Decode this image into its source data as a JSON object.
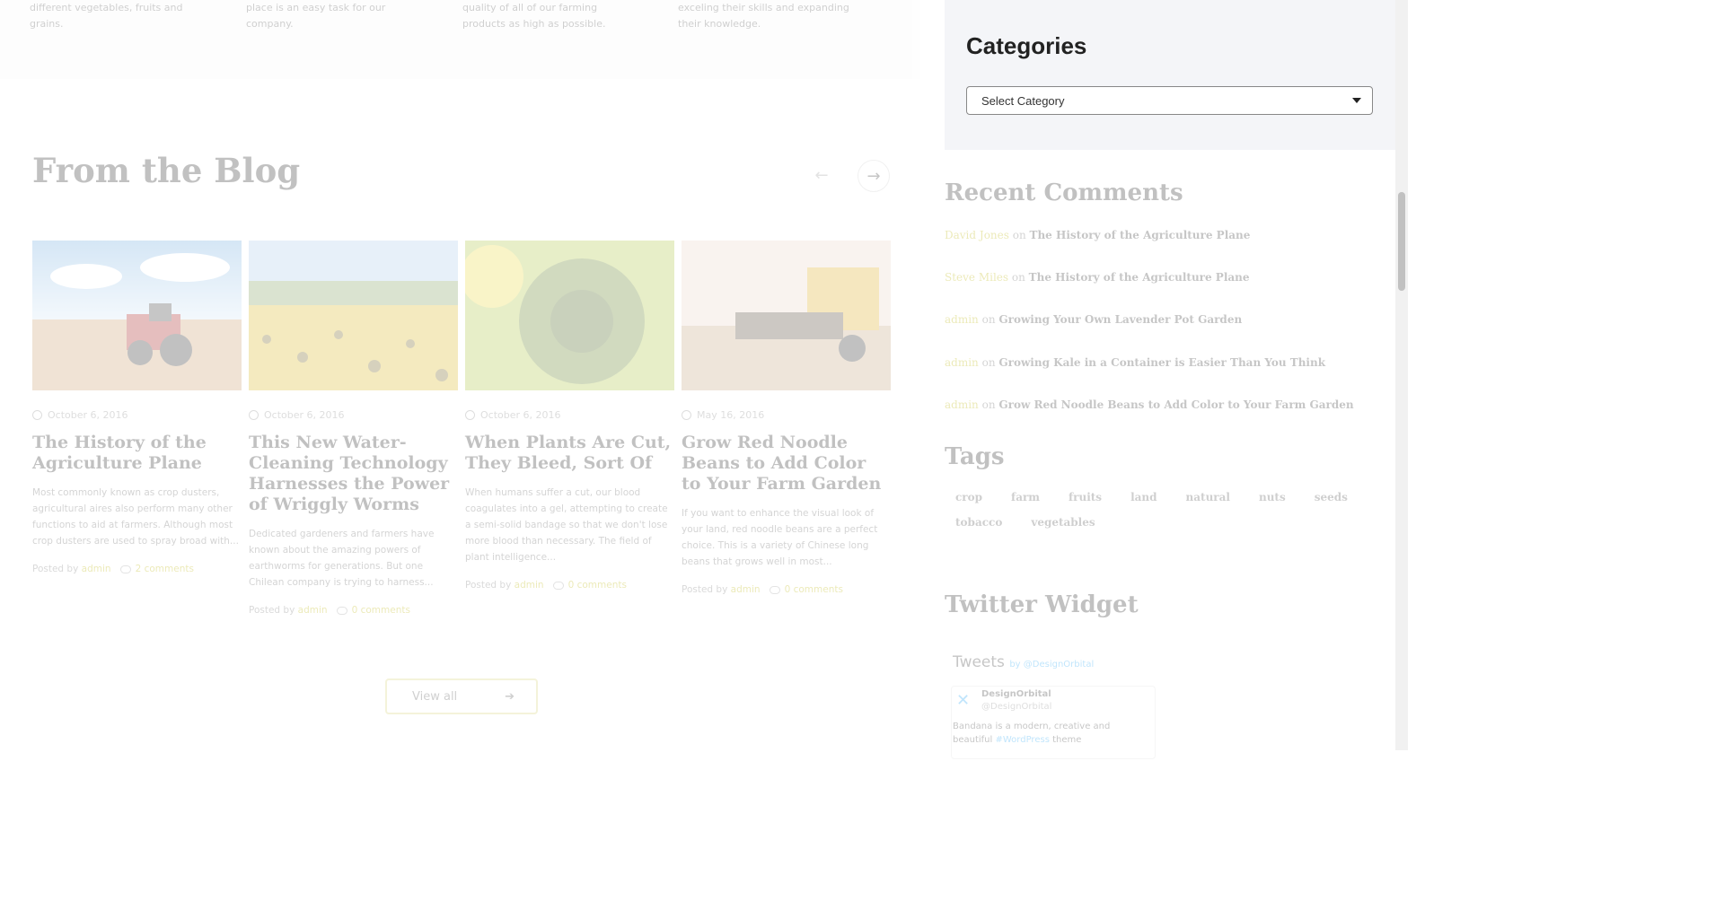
{
  "features": [
    {
      "text": "different vegetables, fruits and grains."
    },
    {
      "text": "place is an easy task for our company."
    },
    {
      "text": "quality of all of our farming products as high as possible."
    },
    {
      "text": "exceling their skills and expanding their knowledge."
    }
  ],
  "blog": {
    "title": "From the Blog",
    "prev_label": "←",
    "next_label": "→",
    "posts": [
      {
        "date": "October 6, 2016",
        "title": "The History of the Agriculture Plane",
        "excerpt": "Most commonly known as crop dusters, agricultural aires also perform many other functions to aid at farmers. Although most crop dusters are used to spray broad with...",
        "posted_by": "Posted by",
        "author": "admin",
        "comments": "2 comments"
      },
      {
        "date": "October 6, 2016",
        "title": "This New Water-Cleaning Technology Harnesses the Power of Wriggly Worms",
        "excerpt": "Dedicated gardeners and farmers have known about the amazing powers of earthworms for generations. But one Chilean company is trying to harness...",
        "posted_by": "Posted by",
        "author": "admin",
        "comments": "0 comments"
      },
      {
        "date": "October 6, 2016",
        "title": "When Plants Are Cut, They Bleed, Sort Of",
        "excerpt": "When humans suffer a cut, our blood coagulates into a gel, attempting to create a semi-solid bandage so that we don't lose more blood than necessary. The field of plant intelligence...",
        "posted_by": "Posted by",
        "author": "admin",
        "comments": "0 comments"
      },
      {
        "date": "May 16, 2016",
        "title": "Grow Red Noodle Beans to Add Color to Your Farm Garden",
        "excerpt": "If you want to enhance the visual look of your land, red noodle beans are a perfect choice. This is a variety of Chinese long beans that grows well in most...",
        "posted_by": "Posted by",
        "author": "admin",
        "comments": "0 comments"
      }
    ],
    "view_all": "View all",
    "view_all_icon": "arrow-right-icon"
  },
  "sidebar": {
    "categories": {
      "title": "Categories",
      "select_value": "Select Category"
    },
    "recent_comments": {
      "title": "Recent Comments",
      "items": [
        {
          "who": "David Jones",
          "on": "on",
          "post": "The History of the Agriculture Plane"
        },
        {
          "who": "Steve Miles",
          "on": "on",
          "post": "The History of the Agriculture Plane"
        },
        {
          "who": "admin",
          "on": "on",
          "post": "Growing Your Own Lavender Pot Garden"
        },
        {
          "who": "admin",
          "on": "on",
          "post": "Growing Kale in a Container is Easier Than You Think"
        },
        {
          "who": "admin",
          "on": "on",
          "post": "Grow Red Noodle Beans to Add Color to Your Farm Garden"
        }
      ]
    },
    "tags": {
      "title": "Tags",
      "items": [
        "crop",
        "farm",
        "fruits",
        "land",
        "natural",
        "nuts",
        "seeds",
        "tobacco",
        "vegetables"
      ]
    },
    "twitter": {
      "title": "Twitter Widget",
      "tweets_label": "Tweets",
      "by_label": "by @DesignOrbital",
      "name": "DesignOrbital",
      "handle": "@DesignOrbital",
      "body": "Bandana is a modern, creative and beautiful",
      "body_link": "#WordPress",
      "body_end": "theme"
    }
  }
}
